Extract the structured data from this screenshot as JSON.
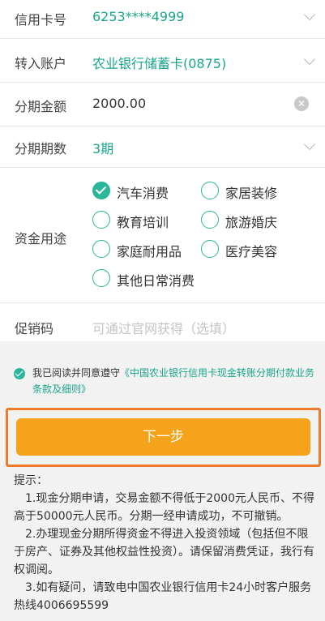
{
  "form": {
    "card": {
      "label": "信用卡号",
      "value": "6253****4999"
    },
    "account": {
      "label": "转入账户",
      "value": "农业银行储蓄卡(0875)"
    },
    "amount": {
      "label": "分期金额",
      "value": "2000.00"
    },
    "periods": {
      "label": "分期期数",
      "value": "3期"
    },
    "purpose": {
      "label": "资金用途",
      "options": [
        {
          "label": "汽车消费",
          "checked": true
        },
        {
          "label": "家居装修",
          "checked": false
        },
        {
          "label": "教育培训",
          "checked": false
        },
        {
          "label": "旅游婚庆",
          "checked": false
        },
        {
          "label": "家庭耐用品",
          "checked": false
        },
        {
          "label": "医疗美容",
          "checked": false
        },
        {
          "label": "其他日常消费",
          "checked": false
        }
      ]
    },
    "promo": {
      "label": "促销码",
      "placeholder": "可通过官网获得（选填）"
    }
  },
  "agreement": {
    "prefix": "我已阅读并同意遵守",
    "link": "《中国农业银行信用卡现金转账分期付款业务条款及细则》",
    "checked": true
  },
  "next_button": "下一步",
  "tips": {
    "title": "提示：",
    "items": [
      "1.现金分期申请，交易金额不得低于2000元人民币、不得高于50000元人民币。分期一经申请成功，不可撤销。",
      "2.办理现金分期所得资金不得进入投资领域（包括但不限于房产、证券及其他权益性投资）。请保留消费凭证，我行有权调阅。",
      "3.如有疑问，请致电中国农业银行信用卡24小时客户服务热线4006695599"
    ]
  },
  "colors": {
    "accent": "#1aa58b",
    "button": "#f5a31a",
    "highlight": "#f07a2c"
  }
}
